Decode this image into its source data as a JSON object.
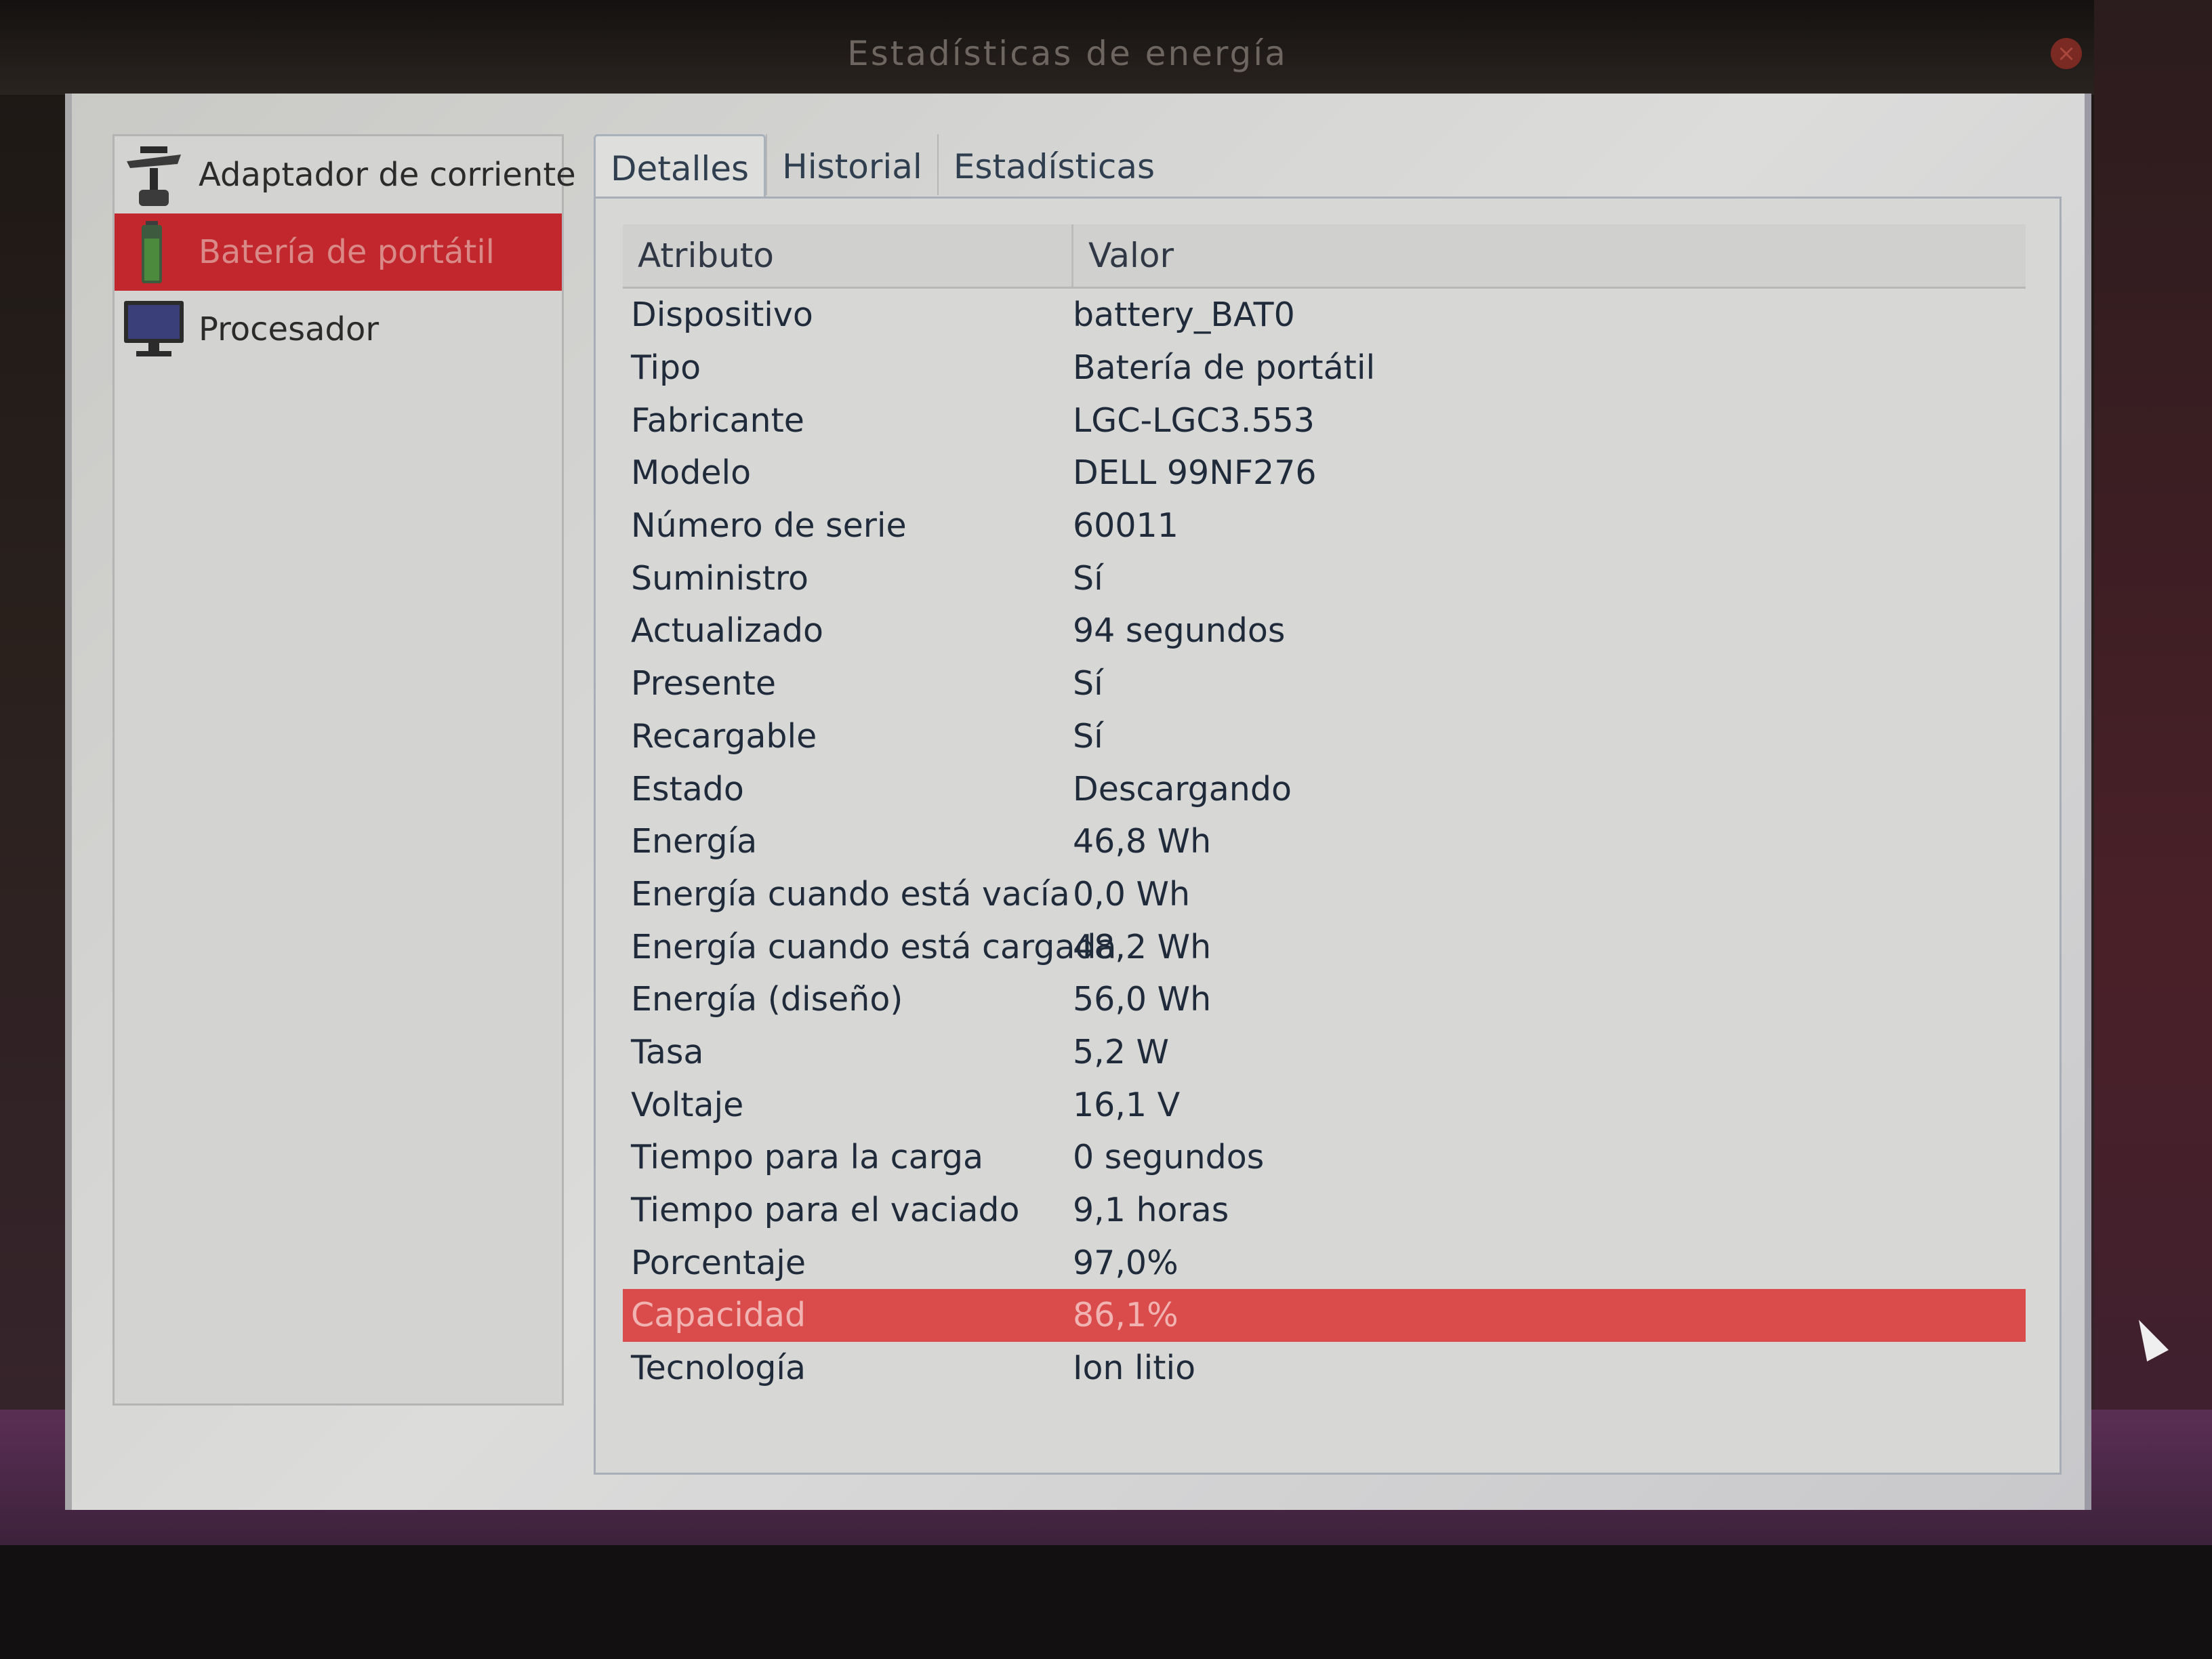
{
  "window": {
    "title": "Estadísticas de energía",
    "close_icon": "close-icon"
  },
  "sidebar": {
    "items": [
      {
        "label": "Adaptador de corriente",
        "icon": "power-plug-icon"
      },
      {
        "label": "Batería de portátil",
        "icon": "battery-icon",
        "selected": true
      },
      {
        "label": "Procesador",
        "icon": "monitor-icon"
      }
    ]
  },
  "tabs": [
    {
      "label": "Detalles",
      "active": true
    },
    {
      "label": "Historial"
    },
    {
      "label": "Estadísticas"
    }
  ],
  "table": {
    "headers": [
      "Atributo",
      "Valor"
    ],
    "rows": [
      {
        "attr": "Dispositivo",
        "val": "battery_BAT0"
      },
      {
        "attr": "Tipo",
        "val": "Batería de portátil"
      },
      {
        "attr": "Fabricante",
        "val": "LGC-LGC3.553"
      },
      {
        "attr": "Modelo",
        "val": "DELL 99NF276"
      },
      {
        "attr": "Número de serie",
        "val": "60011"
      },
      {
        "attr": "Suministro",
        "val": "Sí"
      },
      {
        "attr": "Actualizado",
        "val": "94 segundos"
      },
      {
        "attr": "Presente",
        "val": "Sí"
      },
      {
        "attr": "Recargable",
        "val": "Sí"
      },
      {
        "attr": "Estado",
        "val": "Descargando"
      },
      {
        "attr": "Energía",
        "val": "46,8 Wh"
      },
      {
        "attr": "Energía cuando está vacía",
        "val": "0,0 Wh"
      },
      {
        "attr": "Energía cuando está cargada",
        "val": "48,2 Wh"
      },
      {
        "attr": "Energía (diseño)",
        "val": "56,0 Wh"
      },
      {
        "attr": "Tasa",
        "val": "5,2 W"
      },
      {
        "attr": "Voltaje",
        "val": "16,1 V"
      },
      {
        "attr": "Tiempo para la carga",
        "val": "0 segundos"
      },
      {
        "attr": "Tiempo para el vaciado",
        "val": "9,1 horas"
      },
      {
        "attr": "Porcentaje",
        "val": "97,0%"
      },
      {
        "attr": "Capacidad",
        "val": "86,1%",
        "selected": true
      },
      {
        "attr": "Tecnología",
        "val": "Ion litio"
      }
    ]
  },
  "colors": {
    "selection": "#c1272d",
    "row_selection": "#d94c4b"
  }
}
